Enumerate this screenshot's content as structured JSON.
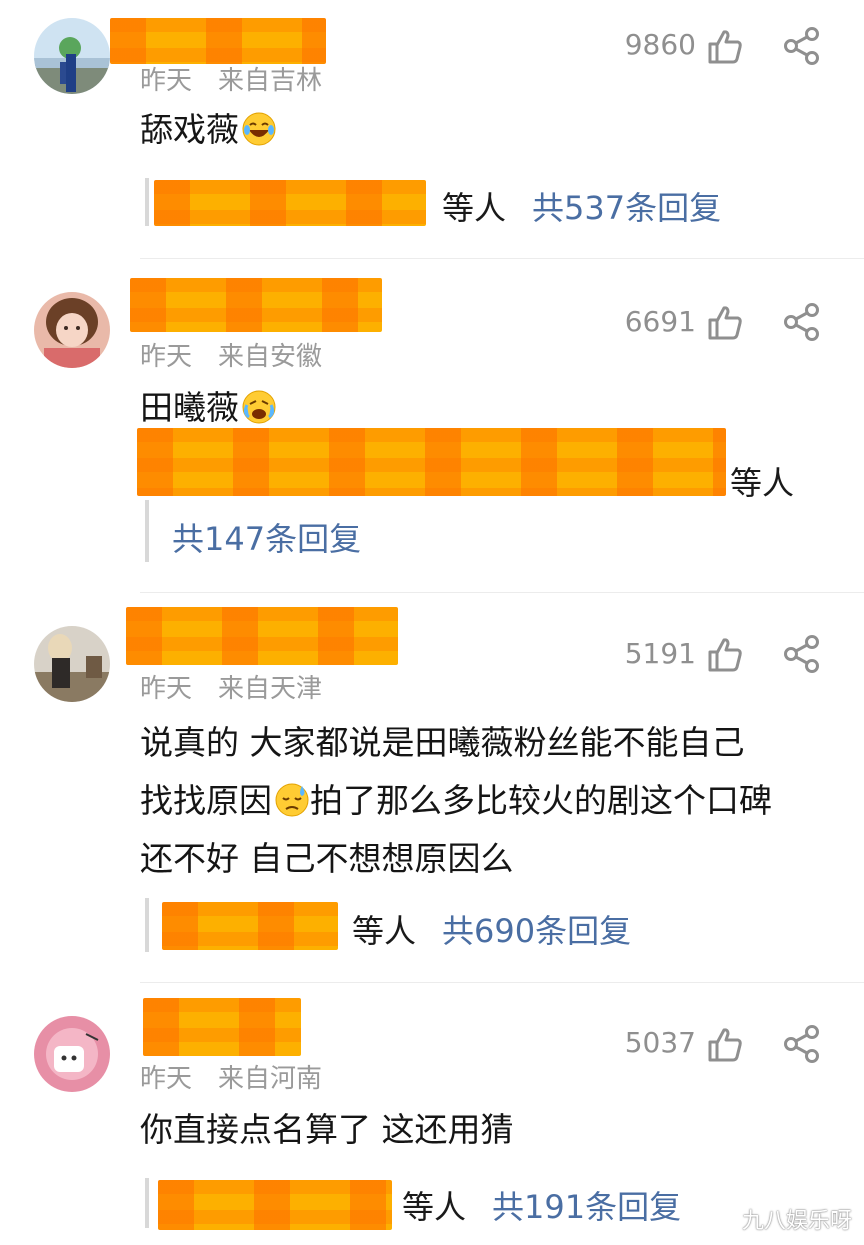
{
  "comments": [
    {
      "time": "昨天",
      "location": "来自吉林",
      "likes": "9860",
      "text": "舔戏薇",
      "emoji": "laughing-tears-emoji",
      "reply_suffix": "等人",
      "reply_count": "共537条回复"
    },
    {
      "time": "昨天",
      "location": "来自安徽",
      "likes": "6691",
      "text": "田曦薇",
      "emoji": "crying-laughing-emoji",
      "reply_suffix": "等人",
      "reply_count": "共147条回复"
    },
    {
      "time": "昨天",
      "location": "来自天津",
      "likes": "5191",
      "lines": [
        "说真的 大家都说是田曦薇粉丝能不能自己",
        "找找原因",
        "拍了那么多比较火的剧这个口碑",
        "还不好 自己不想想原因么"
      ],
      "emoji": "sweat-emoji",
      "reply_suffix": "等人",
      "reply_count": "共690条回复"
    },
    {
      "time": "昨天",
      "location": "来自河南",
      "likes": "5037",
      "text": "你直接点名算了 这还用猜",
      "reply_suffix": "等人",
      "reply_count": "共191条回复"
    }
  ],
  "watermark": "九八娱乐呀",
  "colors": {
    "link": "#4a6ea3",
    "meta": "#9a9a9a",
    "redaction": "#fdb000"
  }
}
